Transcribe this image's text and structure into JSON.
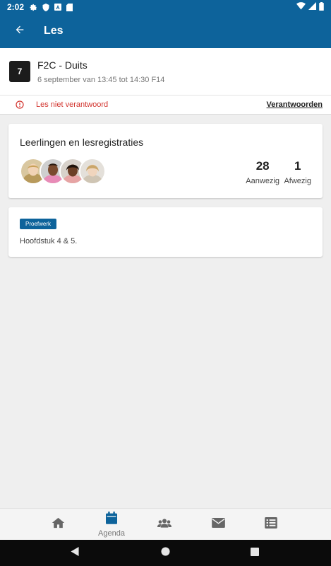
{
  "status_bar": {
    "time": "2:02"
  },
  "app_bar": {
    "title": "Les"
  },
  "lesson": {
    "period": "7",
    "title": "F2C - Duits",
    "subtitle": "6 september van 13:45 tot 14:30 F14"
  },
  "alert": {
    "text": "Les niet verantwoord",
    "action_label": "Verantwoorden",
    "color": "#d2332d"
  },
  "students_card": {
    "title": "Leerlingen en lesregistraties",
    "present_count": "28",
    "present_label": "Aanwezig",
    "absent_count": "1",
    "absent_label": "Afwezig"
  },
  "test_card": {
    "badge": "Proefwerk",
    "description": "Hoofdstuk 4 & 5."
  },
  "bottom_nav": {
    "items": [
      {
        "icon": "home-icon",
        "label": ""
      },
      {
        "icon": "calendar-icon",
        "label": "Agenda",
        "active": true
      },
      {
        "icon": "people-icon",
        "label": ""
      },
      {
        "icon": "envelope-icon",
        "label": ""
      },
      {
        "icon": "list-icon",
        "label": ""
      }
    ]
  },
  "colors": {
    "brand": "#0d639b",
    "background": "#efefef"
  }
}
